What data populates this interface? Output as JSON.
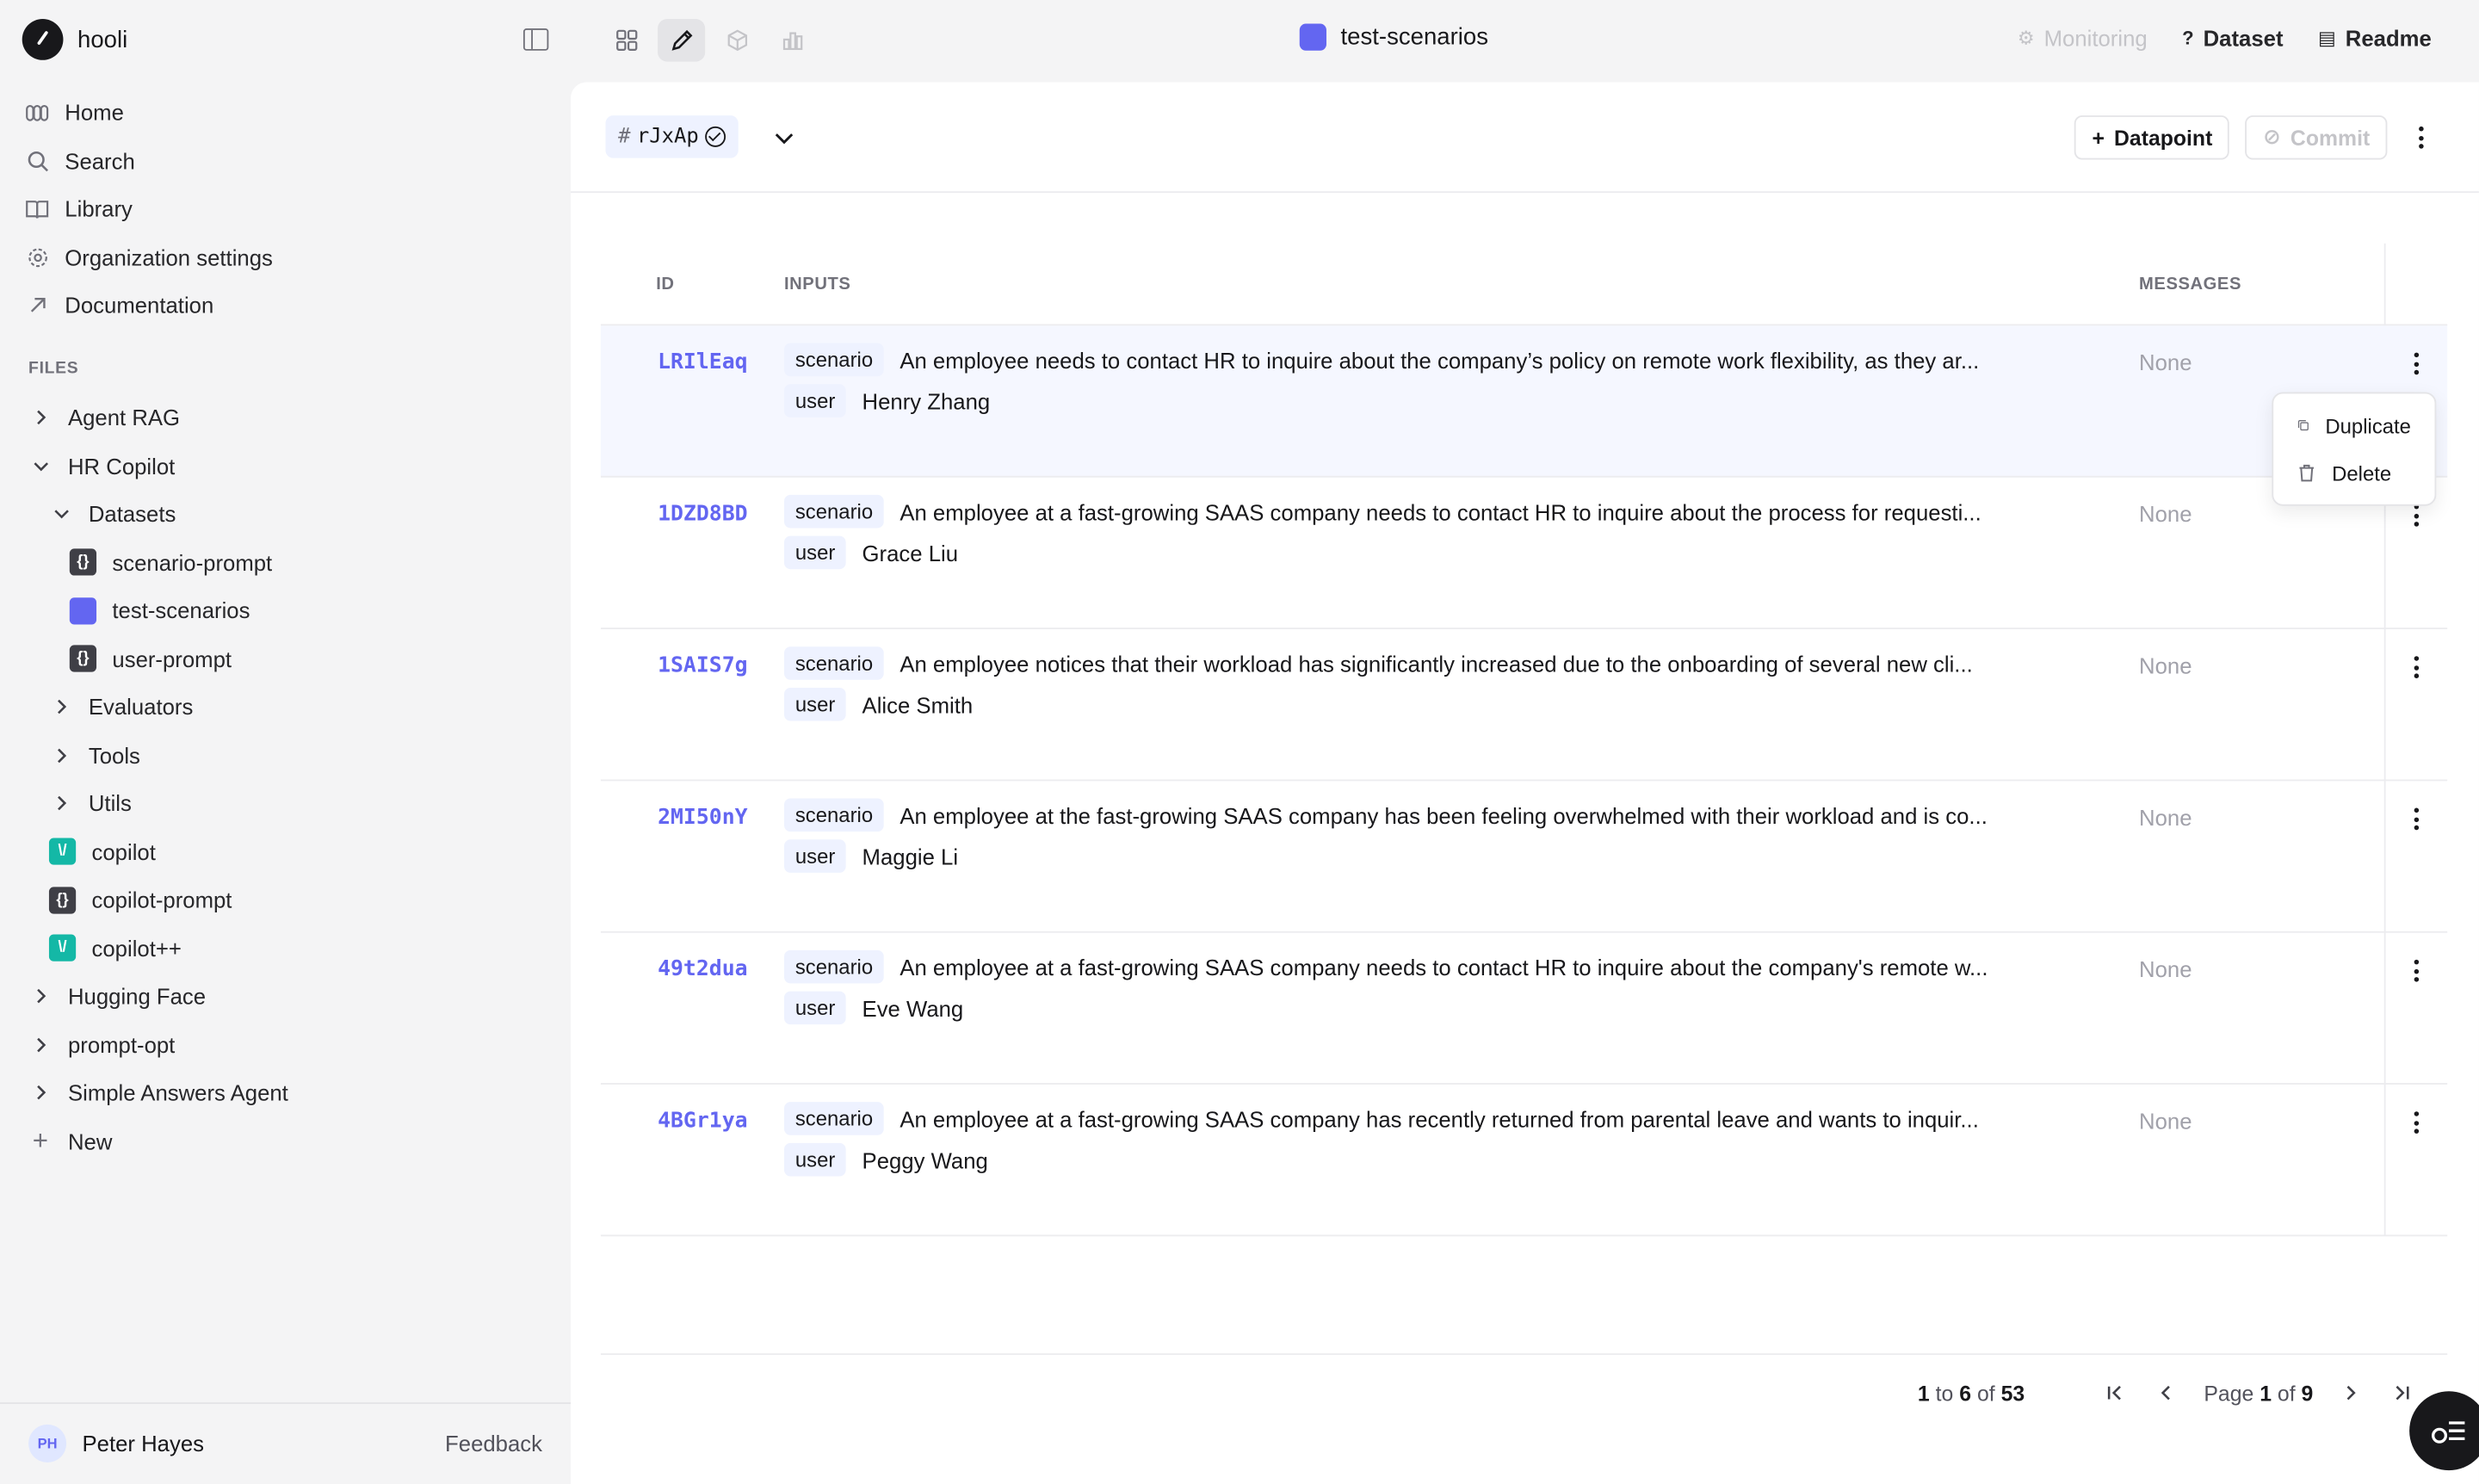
{
  "app": {
    "name": "hooli"
  },
  "nav": [
    {
      "label": "Home",
      "icon": "home-icon"
    },
    {
      "label": "Search",
      "icon": "search-icon"
    },
    {
      "label": "Library",
      "icon": "book-icon"
    },
    {
      "label": "Organization settings",
      "icon": "gear-icon"
    },
    {
      "label": "Documentation",
      "icon": "arrow-up-right-icon"
    }
  ],
  "files": {
    "label": "FILES",
    "items": [
      {
        "label": "Agent RAG",
        "expanded": false
      },
      {
        "label": "HR Copilot",
        "expanded": true
      },
      {
        "label": "Datasets",
        "expanded": true
      },
      {
        "label": "scenario-prompt",
        "type": "prompt"
      },
      {
        "label": "test-scenarios",
        "type": "dataset"
      },
      {
        "label": "user-prompt",
        "type": "prompt"
      },
      {
        "label": "Evaluators",
        "expanded": false
      },
      {
        "label": "Tools",
        "expanded": false
      },
      {
        "label": "Utils",
        "expanded": false
      },
      {
        "label": "copilot",
        "type": "agent"
      },
      {
        "label": "copilot-prompt",
        "type": "prompt"
      },
      {
        "label": "copilot++",
        "type": "agent"
      },
      {
        "label": "Hugging Face",
        "expanded": false
      },
      {
        "label": "prompt-opt",
        "expanded": false
      },
      {
        "label": "Simple Answers Agent",
        "expanded": false
      }
    ],
    "new_label": "New"
  },
  "user": {
    "initials": "PH",
    "name": "Peter Hayes",
    "feedback_label": "Feedback"
  },
  "document": {
    "title": "test-scenarios"
  },
  "top_links": {
    "monitoring": "Monitoring",
    "dataset": "Dataset",
    "readme": "Readme"
  },
  "version": {
    "hash_symbol": "#",
    "id": "rJxAp"
  },
  "actions": {
    "datapoint_label": "Datapoint",
    "commit_label": "Commit"
  },
  "table": {
    "columns": {
      "id": "ID",
      "inputs": "INPUTS",
      "messages": "MESSAGES"
    },
    "input_keys": {
      "scenario": "scenario",
      "user": "user"
    },
    "rows": [
      {
        "id": "LRIlEaq",
        "scenario": "An employee needs to contact HR to inquire about the company’s policy on remote work flexibility, as they ar...",
        "user": "Henry Zhang",
        "messages": "None"
      },
      {
        "id": "1DZD8BD",
        "scenario": "An employee at a fast-growing SAAS company needs to contact HR to inquire about the process for requesti...",
        "user": "Grace Liu",
        "messages": "None"
      },
      {
        "id": "1SAIS7g",
        "scenario": "An employee notices that their workload has significantly increased due to the onboarding of several new cli...",
        "user": "Alice Smith",
        "messages": "None"
      },
      {
        "id": "2MI50nY",
        "scenario": "An employee at the fast-growing SAAS company has been feeling overwhelmed with their workload and is co...",
        "user": "Maggie Li",
        "messages": "None"
      },
      {
        "id": "49t2dua",
        "scenario": "An employee at a fast-growing SAAS company needs to contact HR to inquire about the company's remote w...",
        "user": "Eve Wang",
        "messages": "None"
      },
      {
        "id": "4BGr1ya",
        "scenario": "An employee at a fast-growing SAAS company has recently returned from parental leave and wants to inquir...",
        "user": "Peggy Wang",
        "messages": "None"
      }
    ]
  },
  "pagination": {
    "from": "1",
    "to_word": "to",
    "to": "6",
    "of_word": "of",
    "total": "53",
    "page_word": "Page",
    "page": "1",
    "pages": "9"
  },
  "context_menu": {
    "duplicate": "Duplicate",
    "delete": "Delete"
  },
  "colors": {
    "accent": "#6366f1",
    "agent": "#14b8a6",
    "prompt": "#3f3f46"
  }
}
